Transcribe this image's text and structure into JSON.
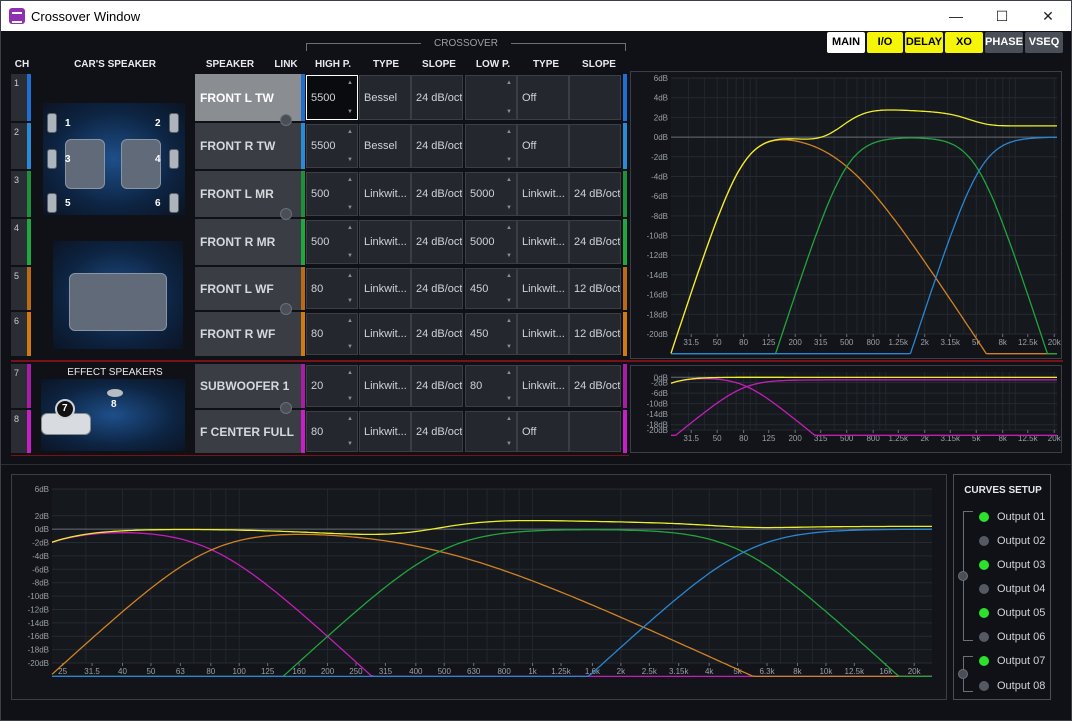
{
  "window": {
    "title": "Crossover Window",
    "min_label": "—",
    "max_label": "☐",
    "close_label": "✕"
  },
  "headers": {
    "ch": "CH",
    "cars_speaker": "CAR'S SPEAKER",
    "speaker": "SPEAKER",
    "link": "LINK",
    "crossover": "CROSSOVER",
    "high_p": "HIGH P.",
    "type1": "TYPE",
    "slope1": "SLOPE",
    "low_p": "LOW P.",
    "type2": "TYPE",
    "slope2": "SLOPE",
    "effect_speakers": "EFFECT SPEAKERS"
  },
  "mode_buttons": [
    {
      "label": "MAIN",
      "bg": "#ffffff",
      "fg": "#000000"
    },
    {
      "label": "I/O",
      "bg": "#f5f50a",
      "fg": "#000000"
    },
    {
      "label": "DELAY",
      "bg": "#f5f50a",
      "fg": "#000000"
    },
    {
      "label": "XO",
      "bg": "#f5f50a",
      "fg": "#000000"
    },
    {
      "label": "PHASE",
      "bg": "#4a4e56",
      "fg": "#ffffff"
    },
    {
      "label": "VSEQ",
      "bg": "#4a4e56",
      "fg": "#ffffff"
    }
  ],
  "car_numbers": [
    "1",
    "2",
    "3",
    "4",
    "5",
    "6",
    "7",
    "8"
  ],
  "channels": [
    {
      "ch": "1",
      "color": "#1f6fd1",
      "speaker": "FRONT L TW",
      "hp": "5500",
      "hp_type": "Bessel",
      "hp_slope": "24 dB/oct",
      "lp": "",
      "lp_type": "Off",
      "lp_slope": "",
      "selected": true
    },
    {
      "ch": "2",
      "color": "#2b8ad6",
      "speaker": "FRONT R TW",
      "hp": "5500",
      "hp_type": "Bessel",
      "hp_slope": "24 dB/oct",
      "lp": "",
      "lp_type": "Off",
      "lp_slope": ""
    },
    {
      "ch": "3",
      "color": "#1e8f3a",
      "speaker": "FRONT L MR",
      "hp": "500",
      "hp_type": "Linkwit...",
      "hp_slope": "24 dB/oct",
      "lp": "5000",
      "lp_type": "Linkwit...",
      "lp_slope": "24 dB/oct"
    },
    {
      "ch": "4",
      "color": "#1ea83e",
      "speaker": "FRONT R MR",
      "hp": "500",
      "hp_type": "Linkwit...",
      "hp_slope": "24 dB/oct",
      "lp": "5000",
      "lp_type": "Linkwit...",
      "lp_slope": "24 dB/oct"
    },
    {
      "ch": "5",
      "color": "#b86a14",
      "speaker": "FRONT L WF",
      "hp": "80",
      "hp_type": "Linkwit...",
      "hp_slope": "24 dB/oct",
      "lp": "450",
      "lp_type": "Linkwit...",
      "lp_slope": "12 dB/oct"
    },
    {
      "ch": "6",
      "color": "#d07a10",
      "speaker": "FRONT R WF",
      "hp": "80",
      "hp_type": "Linkwit...",
      "hp_slope": "24 dB/oct",
      "lp": "450",
      "lp_type": "Linkwit...",
      "lp_slope": "12 dB/oct"
    },
    {
      "ch": "7",
      "color": "#a51ea5",
      "speaker": "SUBWOOFER 1",
      "hp": "20",
      "hp_type": "Linkwit...",
      "hp_slope": "24 dB/oct",
      "lp": "80",
      "lp_type": "Linkwit...",
      "lp_slope": "24 dB/oct"
    },
    {
      "ch": "8",
      "color": "#c81ec8",
      "speaker": "F CENTER FULL",
      "hp": "80",
      "hp_type": "Linkwit...",
      "hp_slope": "24 dB/oct",
      "lp": "",
      "lp_type": "Off",
      "lp_slope": ""
    }
  ],
  "graph_top": {
    "yticks": [
      "6dB",
      "4dB",
      "2dB",
      "0dB",
      "-2dB",
      "-4dB",
      "-6dB",
      "-8dB",
      "-10dB",
      "-12dB",
      "-14dB",
      "-16dB",
      "-18dB",
      "-20dB"
    ],
    "xticks": [
      "31.5",
      "50",
      "80",
      "125",
      "200",
      "315",
      "500",
      "800",
      "1.25k",
      "2k",
      "3.15k",
      "5k",
      "8k",
      "12.5k",
      "20k"
    ]
  },
  "graph_mid": {
    "yticks": [
      "0dB",
      "-2dB",
      "-6dB",
      "-10dB",
      "-14dB",
      "-18dB",
      "-20dB"
    ],
    "xticks": [
      "31.5",
      "50",
      "80",
      "125",
      "200",
      "315",
      "500",
      "800",
      "1.25k",
      "2k",
      "3.15k",
      "5k",
      "8k",
      "12.5k",
      "20k"
    ]
  },
  "graph_bottom": {
    "yticks": [
      "6dB",
      "2dB",
      "0dB",
      "-2dB",
      "-4dB",
      "-6dB",
      "-8dB",
      "-10dB",
      "-12dB",
      "-14dB",
      "-16dB",
      "-18dB",
      "-20dB"
    ],
    "xticks": [
      "25",
      "31.5",
      "40",
      "50",
      "63",
      "80",
      "100",
      "125",
      "160",
      "200",
      "250",
      "315",
      "400",
      "500",
      "630",
      "800",
      "1k",
      "1.25k",
      "1.6k",
      "2k",
      "2.5k",
      "3.15k",
      "4k",
      "5k",
      "6.3k",
      "8k",
      "10k",
      "12.5k",
      "16k",
      "20k"
    ]
  },
  "curves_setup": {
    "title": "CURVES SETUP",
    "outputs": [
      {
        "label": "Output 01",
        "on": true
      },
      {
        "label": "Output 02",
        "on": false
      },
      {
        "label": "Output 03",
        "on": true
      },
      {
        "label": "Output 04",
        "on": false
      },
      {
        "label": "Output 05",
        "on": true
      },
      {
        "label": "Output 06",
        "on": false
      },
      {
        "label": "Output 07",
        "on": true
      },
      {
        "label": "Output 08",
        "on": false
      }
    ]
  },
  "colors": {
    "yellow": "#f0ee2a",
    "orange": "#d08224",
    "green": "#22a43e",
    "blue": "#2a86d2",
    "magenta": "#c21fb8",
    "led_on": "#2ee02e",
    "led_off": "#555a62"
  }
}
